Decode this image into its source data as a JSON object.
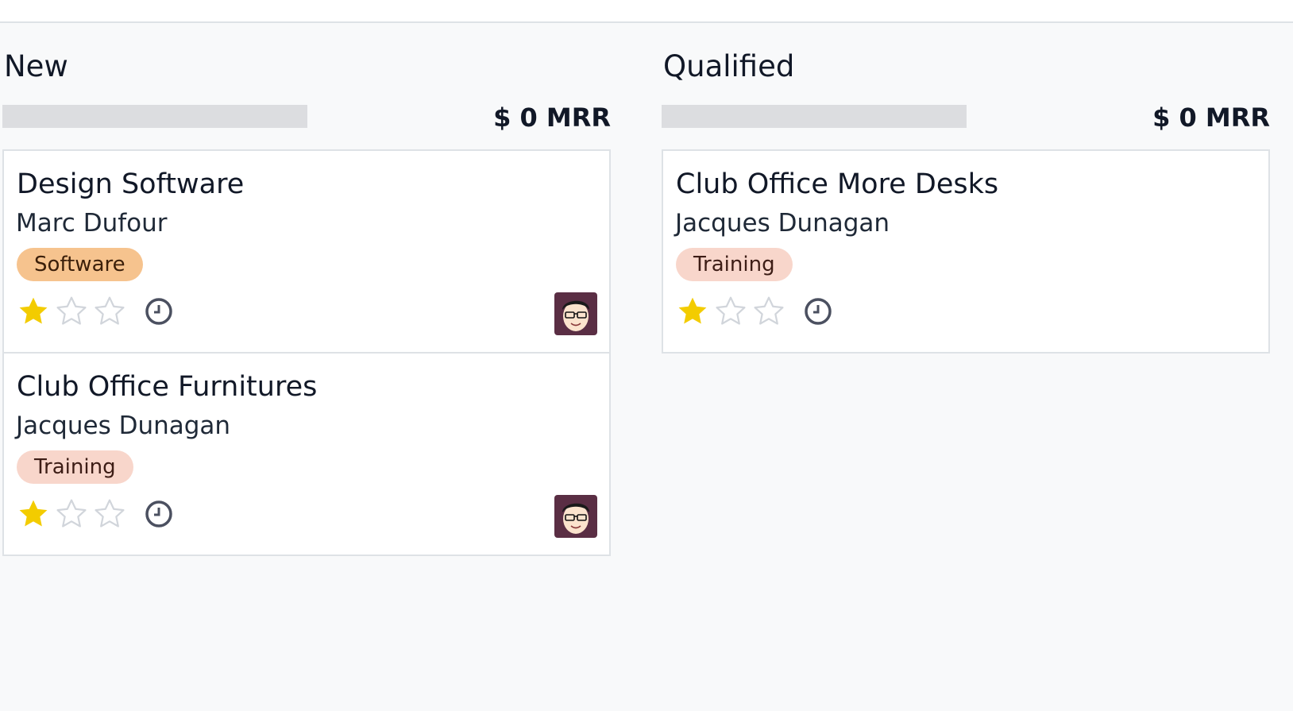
{
  "columns": [
    {
      "title": "New",
      "mrr": "$ 0 MRR",
      "cards": [
        {
          "title": "Design Software",
          "contact": "Marc Dufour",
          "tag": "Software",
          "rating": 1,
          "has_avatar": true
        },
        {
          "title": "Club Office Furnitures",
          "contact": "Jacques Dunagan",
          "tag": "Training",
          "rating": 1,
          "has_avatar": true
        }
      ]
    },
    {
      "title": "Qualified",
      "mrr": "$ 0 MRR",
      "cards": [
        {
          "title": "Club Office More Desks",
          "contact": "Jacques Dunagan",
          "tag": "Training",
          "rating": 1,
          "has_avatar": false
        }
      ]
    }
  ],
  "colors": {
    "star_filled": "#f3cc00",
    "star_empty": "#d1d5db",
    "tag_software_bg": "#f6c38e",
    "tag_training_bg": "#f8d6cb",
    "progress_empty": "#dcdde0"
  },
  "icons": {
    "star": "star-icon",
    "activity": "clock-icon",
    "avatar": "user-avatar-icon"
  }
}
